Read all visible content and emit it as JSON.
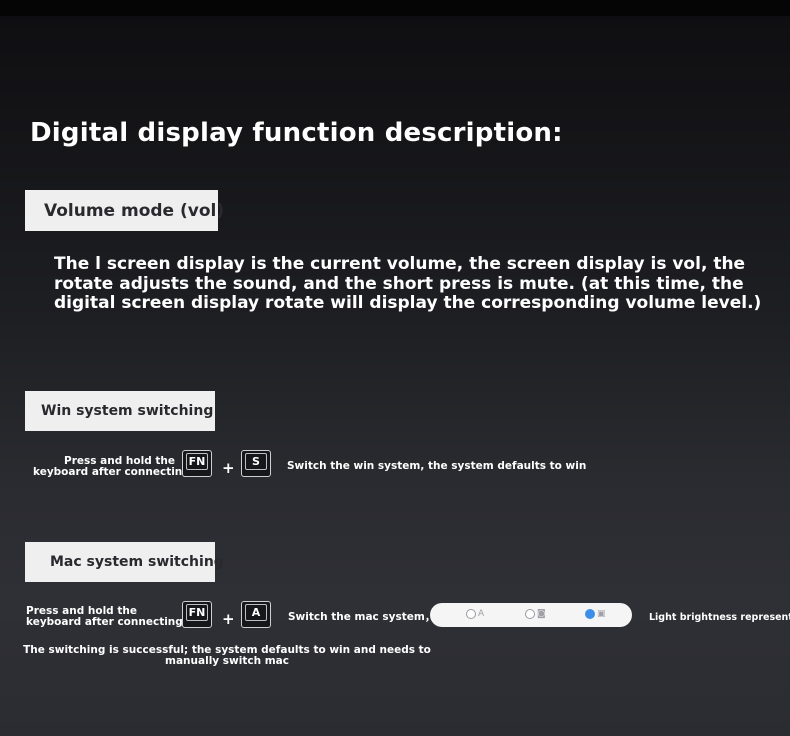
{
  "title": "Digital display function description:",
  "volume": {
    "tag": "Volume mode (vol)",
    "description": "The l screen display is the current volume, the screen display is vol, the rotate adjusts the sound, and the short press is mute. (at this time, the digital screen display rotate will display the corresponding volume level.)"
  },
  "win": {
    "tag": "Win system switching",
    "press_line1": "Press and hold the",
    "press_line2": "keyboard after connecting",
    "key1": "FN",
    "plus": "+",
    "key2": "S",
    "note": "Switch the win system, the system defaults to win"
  },
  "mac": {
    "tag": "Mac system switching",
    "press_line1": "Press and hold the",
    "press_line2": "keyboard after connecting",
    "key1": "FN",
    "plus": "+",
    "key2": "A",
    "note": "Switch the mac system，",
    "light_note": "Light brightness represents",
    "success": "The switching is successful; the system defaults to win and needs to manually switch mac",
    "slider_options": [
      {
        "icon": "letter-a-icon",
        "glyph": "A",
        "selected": false
      },
      {
        "icon": "camera-icon",
        "glyph": "◙",
        "selected": false
      },
      {
        "icon": "screen-icon",
        "glyph": "▣",
        "selected": true
      }
    ]
  },
  "colors": {
    "tag_bg": "#efeff0",
    "tag_text": "#2a2a2e",
    "selected_dot": "#3d8ee8"
  }
}
